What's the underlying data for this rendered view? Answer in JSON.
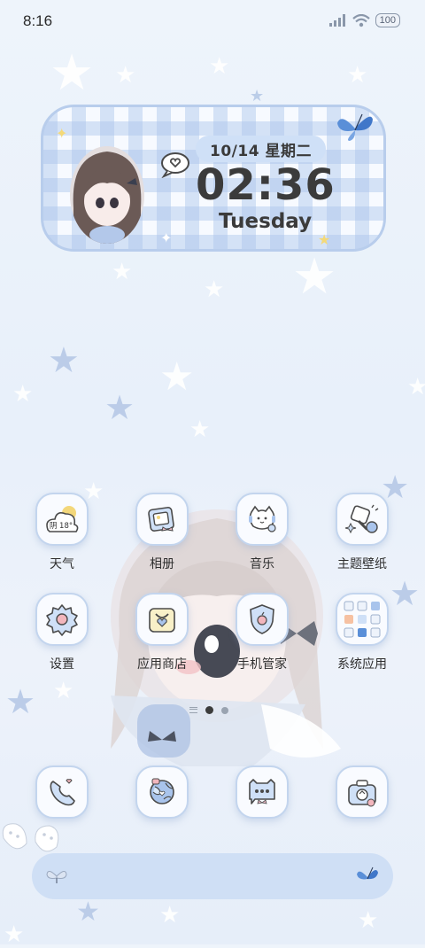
{
  "status_bar": {
    "time": "8:16",
    "battery": "100",
    "icons": [
      "signal-icon",
      "wifi-icon",
      "battery-icon"
    ]
  },
  "clock_widget": {
    "date": "10/14 星期二",
    "time": "02:36",
    "weekday": "Tuesday"
  },
  "weather_icon_text": "阴 18°",
  "apps": [
    {
      "label": "天气",
      "icon": "weather-icon"
    },
    {
      "label": "相册",
      "icon": "gallery-icon"
    },
    {
      "label": "音乐",
      "icon": "music-icon"
    },
    {
      "label": "主题壁纸",
      "icon": "theme-icon"
    },
    {
      "label": "设置",
      "icon": "settings-icon"
    },
    {
      "label": "应用商店",
      "icon": "app-store-icon"
    },
    {
      "label": "手机管家",
      "icon": "security-icon"
    },
    {
      "label": "系统应用",
      "icon": "system-apps-folder-icon"
    }
  ],
  "page_indicator": {
    "pages": 2,
    "current": 1
  },
  "dock": [
    "phone-icon",
    "browser-icon",
    "messages-icon",
    "camera-icon"
  ],
  "colors": {
    "accent": "#b8cdec",
    "pill": "#cfe0f7",
    "search_bar": "#cfdff5",
    "butterfly": "#5a8fd8"
  }
}
